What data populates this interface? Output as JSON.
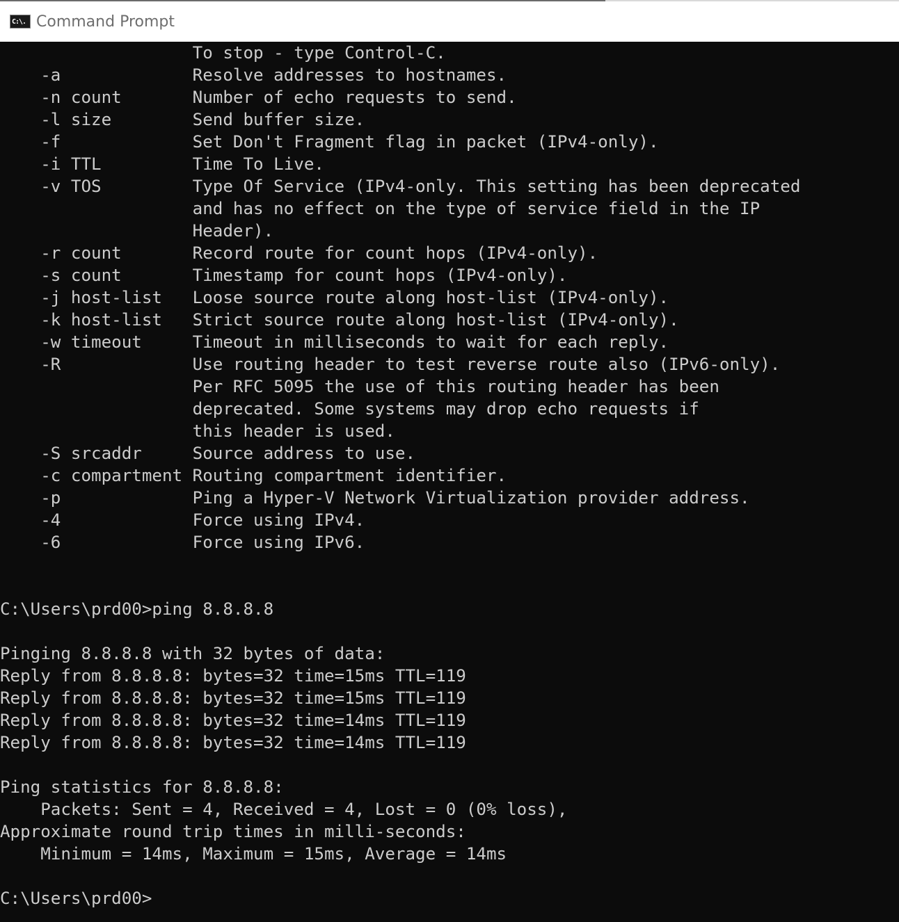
{
  "window": {
    "title": "Command Prompt",
    "icon": "cmd-icon",
    "icon_text": "C:\\."
  },
  "colors": {
    "background": "#0c0c0c",
    "foreground": "#cccccc",
    "titlebar": "#ffffff",
    "title_text": "#6e6e6e"
  },
  "console": {
    "lines": [
      "                   To stop - type Control-C.",
      "    -a             Resolve addresses to hostnames.",
      "    -n count       Number of echo requests to send.",
      "    -l size        Send buffer size.",
      "    -f             Set Don't Fragment flag in packet (IPv4-only).",
      "    -i TTL         Time To Live.",
      "    -v TOS         Type Of Service (IPv4-only. This setting has been deprecated",
      "                   and has no effect on the type of service field in the IP",
      "                   Header).",
      "    -r count       Record route for count hops (IPv4-only).",
      "    -s count       Timestamp for count hops (IPv4-only).",
      "    -j host-list   Loose source route along host-list (IPv4-only).",
      "    -k host-list   Strict source route along host-list (IPv4-only).",
      "    -w timeout     Timeout in milliseconds to wait for each reply.",
      "    -R             Use routing header to test reverse route also (IPv6-only).",
      "                   Per RFC 5095 the use of this routing header has been",
      "                   deprecated. Some systems may drop echo requests if",
      "                   this header is used.",
      "    -S srcaddr     Source address to use.",
      "    -c compartment Routing compartment identifier.",
      "    -p             Ping a Hyper-V Network Virtualization provider address.",
      "    -4             Force using IPv4.",
      "    -6             Force using IPv6.",
      "",
      "",
      "C:\\Users\\prd00>ping 8.8.8.8",
      "",
      "Pinging 8.8.8.8 with 32 bytes of data:",
      "Reply from 8.8.8.8: bytes=32 time=15ms TTL=119",
      "Reply from 8.8.8.8: bytes=32 time=15ms TTL=119",
      "Reply from 8.8.8.8: bytes=32 time=14ms TTL=119",
      "Reply from 8.8.8.8: bytes=32 time=14ms TTL=119",
      "",
      "Ping statistics for 8.8.8.8:",
      "    Packets: Sent = 4, Received = 4, Lost = 0 (0% loss),",
      "Approximate round trip times in milli-seconds:",
      "    Minimum = 14ms, Maximum = 15ms, Average = 14ms",
      "",
      "C:\\Users\\prd00>"
    ]
  }
}
